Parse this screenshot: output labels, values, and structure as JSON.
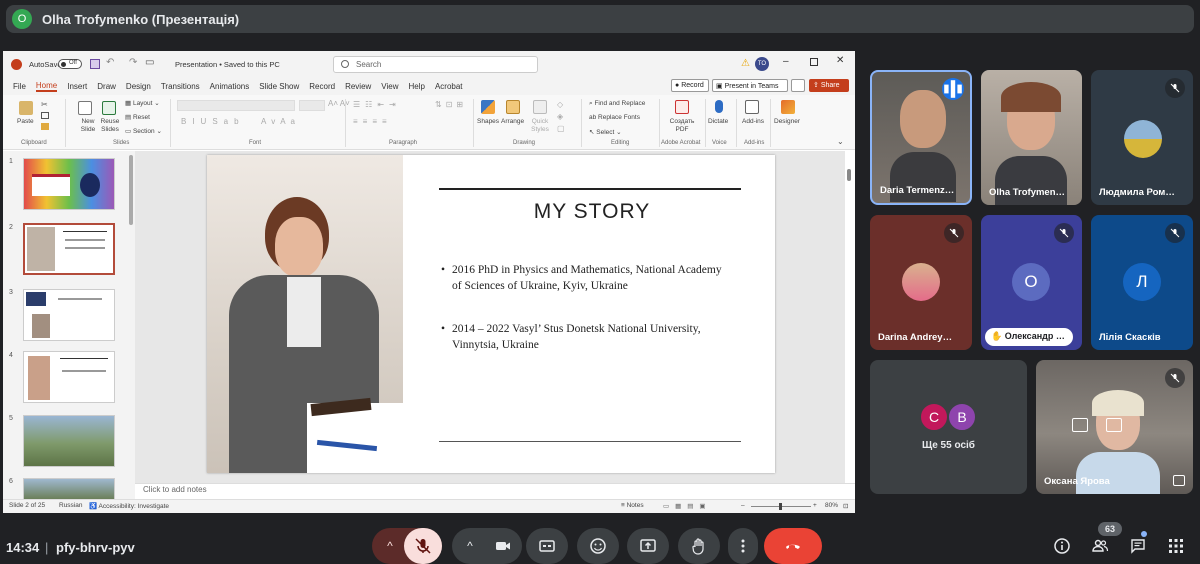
{
  "presenter_bar": {
    "avatar_letter": "O",
    "title": "Olha Trofymenko (Презентація)"
  },
  "ppt": {
    "autosave_label": "AutoSave",
    "autosave_state": "Off",
    "doc_title": "Presentation • Saved to this PC",
    "search_placeholder": "Search",
    "user_initials": "TO",
    "menu": [
      "File",
      "Home",
      "Insert",
      "Draw",
      "Design",
      "Transitions",
      "Animations",
      "Slide Show",
      "Record",
      "Review",
      "View",
      "Help",
      "Acrobat"
    ],
    "record_button": "Record",
    "teams_button": "Present in Teams",
    "share_button": "Share",
    "ribbon": {
      "paste": "Paste",
      "clipboard": "Clipboard",
      "new_slide": "New Slide",
      "reuse_slides": "Reuse Slides",
      "layout": "Layout",
      "reset": "Reset",
      "section": "Section",
      "slides": "Slides",
      "font": "Font",
      "paragraph": "Paragraph",
      "shapes": "Shapes",
      "arrange": "Arrange",
      "quick_styles": "Quick Styles",
      "drawing": "Drawing",
      "find_replace": "Find and Replace",
      "replace_fonts": "Replace Fonts",
      "select": "Select",
      "editing": "Editing",
      "create_pdf": "Создать PDF",
      "adobe_acrobat": "Adobe Acrobat",
      "dictate": "Dictate",
      "voice": "Voice",
      "add_ins": "Add-ins",
      "add_ins_group": "Add-ins",
      "designer": "Designer"
    },
    "thumbnails": [
      "1",
      "2",
      "3",
      "4",
      "5",
      "6"
    ],
    "slide": {
      "title": "MY STORY",
      "bullets": [
        "2016 PhD in Physics and Mathematics, National Academy of Sciences of Ukraine, Kyiv, Ukraine",
        "2014 – 2022 Vasyl’ Stus Donetsk National University, Vinnytsia, Ukraine"
      ]
    },
    "notes_placeholder": "Click to add notes",
    "status": {
      "slide_count": "Slide 2 of 25",
      "language": "Russian",
      "accessibility": "Accessibility: Investigate",
      "notes": "Notes",
      "zoom": "80%"
    }
  },
  "participants": [
    {
      "name": "Daria Termenz…",
      "speaking": true
    },
    {
      "name": "Olha Trofymen…"
    },
    {
      "name": "Людмила Ром…",
      "muted": true
    },
    {
      "name": "Darina Andrey…",
      "muted": true
    },
    {
      "name": "Олександр …",
      "letter": "О",
      "color": "#5c6bc0",
      "muted": true
    },
    {
      "name": "Лілія Скаскiв",
      "letter": "Л",
      "color": "#1565c0",
      "muted": true
    },
    {
      "name": "Оксана Ярова",
      "muted": true
    }
  ],
  "others_tile": {
    "label": "Ще 55 осіб",
    "avatars": [
      {
        "letter": "С",
        "color": "#c2185b"
      },
      {
        "letter": "В",
        "color": "#8e44ad"
      }
    ]
  },
  "bottom_bar": {
    "time": "14:34",
    "separator": "|",
    "meeting_code": "pfy-bhrv-pyv",
    "people_count": "63"
  },
  "colors": {
    "end_call": "#ea4335",
    "mic_off_bg": "#f9dedc",
    "accent": "#8ab4f8",
    "ppt_accent": "#c43e1c"
  }
}
